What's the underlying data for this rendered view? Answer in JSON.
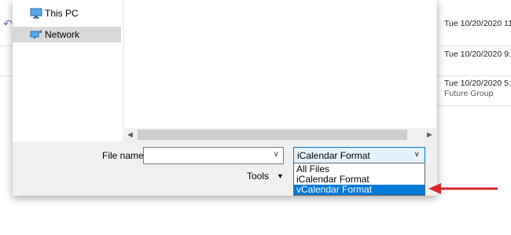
{
  "background": {
    "rows": [
      {
        "date": "Tue 10/20/2020 11:"
      },
      {
        "date": "Tue 10/20/2020 9:2"
      },
      {
        "date": "Tue 10/20/2020 5:0",
        "group": "Future Group"
      }
    ]
  },
  "sidebar": {
    "items": [
      {
        "label": "This PC",
        "icon": "monitor-icon"
      },
      {
        "label": "Network",
        "icon": "network-icon",
        "selected": true
      }
    ]
  },
  "filename": {
    "label": "File name:",
    "value": ""
  },
  "filetype": {
    "selected": "iCalendar Format",
    "options": [
      "All Files",
      "iCalendar Format",
      "vCalendar Format"
    ],
    "highlighted": "vCalendar Format"
  },
  "tools": {
    "label": "Tools"
  },
  "colors": {
    "selection": "#0078d7",
    "arrow": "#d9262c"
  }
}
